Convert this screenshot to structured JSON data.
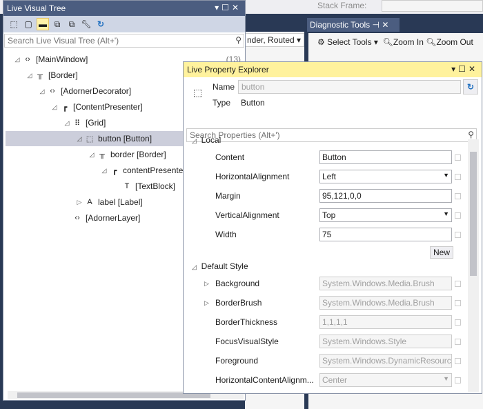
{
  "background": {
    "stack_frame_label": "Stack Frame:",
    "middle_dropdown": "nder, Routed",
    "diagnostic_tab": "Diagnostic Tools",
    "select_tools": "Select Tools",
    "zoom_in": "Zoom In",
    "zoom_out": "Zoom Out"
  },
  "visual_tree": {
    "title": "Live Visual Tree",
    "search_placeholder": "Search Live Visual Tree (Alt+')",
    "items": [
      {
        "label": "[MainWindow]",
        "count": "(13)",
        "icon": "window-icon",
        "expanded": true
      },
      {
        "label": "[Border]",
        "icon": "border-icon",
        "expanded": true
      },
      {
        "label": "[AdornerDecorator]",
        "icon": "code-icon",
        "expanded": true
      },
      {
        "label": "[ContentPresenter]",
        "icon": "content-presenter-icon",
        "expanded": true
      },
      {
        "label": "[Grid]",
        "icon": "grid-icon",
        "expanded": true
      },
      {
        "label": "button [Button]",
        "icon": "button-icon",
        "expanded": true,
        "selected": true
      },
      {
        "label": "border [Border]",
        "icon": "border-icon",
        "expanded": true
      },
      {
        "label": "contentPresenter",
        "icon": "content-presenter-icon",
        "expanded": true
      },
      {
        "label": "[TextBlock]",
        "icon": "textblock-icon"
      },
      {
        "label": "label [Label]",
        "icon": "label-icon",
        "expanded": false
      },
      {
        "label": "[AdornerLayer]",
        "icon": "code-icon"
      }
    ]
  },
  "property_explorer": {
    "title": "Live Property Explorer",
    "name_label": "Name",
    "name_value": "button",
    "type_label": "Type",
    "type_value": "Button",
    "search_placeholder": "Search Properties (Alt+')",
    "local_header": "Local",
    "new_button": "New",
    "default_style_header": "Default Style",
    "local": [
      {
        "name": "Content",
        "value": "Button"
      },
      {
        "name": "HorizontalAlignment",
        "value": "Left",
        "dropdown": true
      },
      {
        "name": "Margin",
        "value": "95,121,0,0"
      },
      {
        "name": "VerticalAlignment",
        "value": "Top",
        "dropdown": true
      },
      {
        "name": "Width",
        "value": "75"
      }
    ],
    "default_style": [
      {
        "name": "Background",
        "value": "System.Windows.Media.Brush",
        "expandable": true
      },
      {
        "name": "BorderBrush",
        "value": "System.Windows.Media.Brush",
        "expandable": true
      },
      {
        "name": "BorderThickness",
        "value": "1,1,1,1"
      },
      {
        "name": "FocusVisualStyle",
        "value": "System.Windows.Style"
      },
      {
        "name": "Foreground",
        "value": "System.Windows.DynamicResource"
      },
      {
        "name": "HorizontalContentAlignm...",
        "value": "Center",
        "dropdown": true
      }
    ]
  },
  "colors": {
    "title_bar": "#4b5d80",
    "active_title_bar": "#fff29d",
    "selection": "#cccedb"
  }
}
